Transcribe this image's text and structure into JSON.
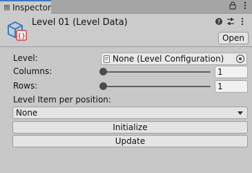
{
  "window": {
    "tab_label": "Inspector",
    "tab_icon": "info-icon",
    "tab_controls": [
      "lock-icon",
      "kebab-menu-icon"
    ]
  },
  "header": {
    "title": "Level 01 (Level Data)",
    "asset_icon": "scriptable-object-icon",
    "tools": [
      "help-icon",
      "preset-sliders-icon",
      "kebab-menu-icon"
    ],
    "open_label": "Open"
  },
  "fields": {
    "level": {
      "label": "Level:",
      "value": "None (Level Configuration)",
      "icon": "script-file-icon",
      "picker_icon": "object-picker-icon"
    },
    "columns": {
      "label": "Columns:",
      "value": "1",
      "slider_fraction": 0.0
    },
    "rows": {
      "label": "Rows:",
      "value": "1",
      "slider_fraction": 0.0
    },
    "level_item": {
      "label": "Level Item per position:",
      "selected": "None"
    }
  },
  "buttons": {
    "initialize": "Initialize",
    "update": "Update"
  },
  "colors": {
    "tab_accent": "#3a79bb",
    "asset_icon_blue": "#2f7fc8",
    "asset_icon_red": "#d23a3a"
  }
}
